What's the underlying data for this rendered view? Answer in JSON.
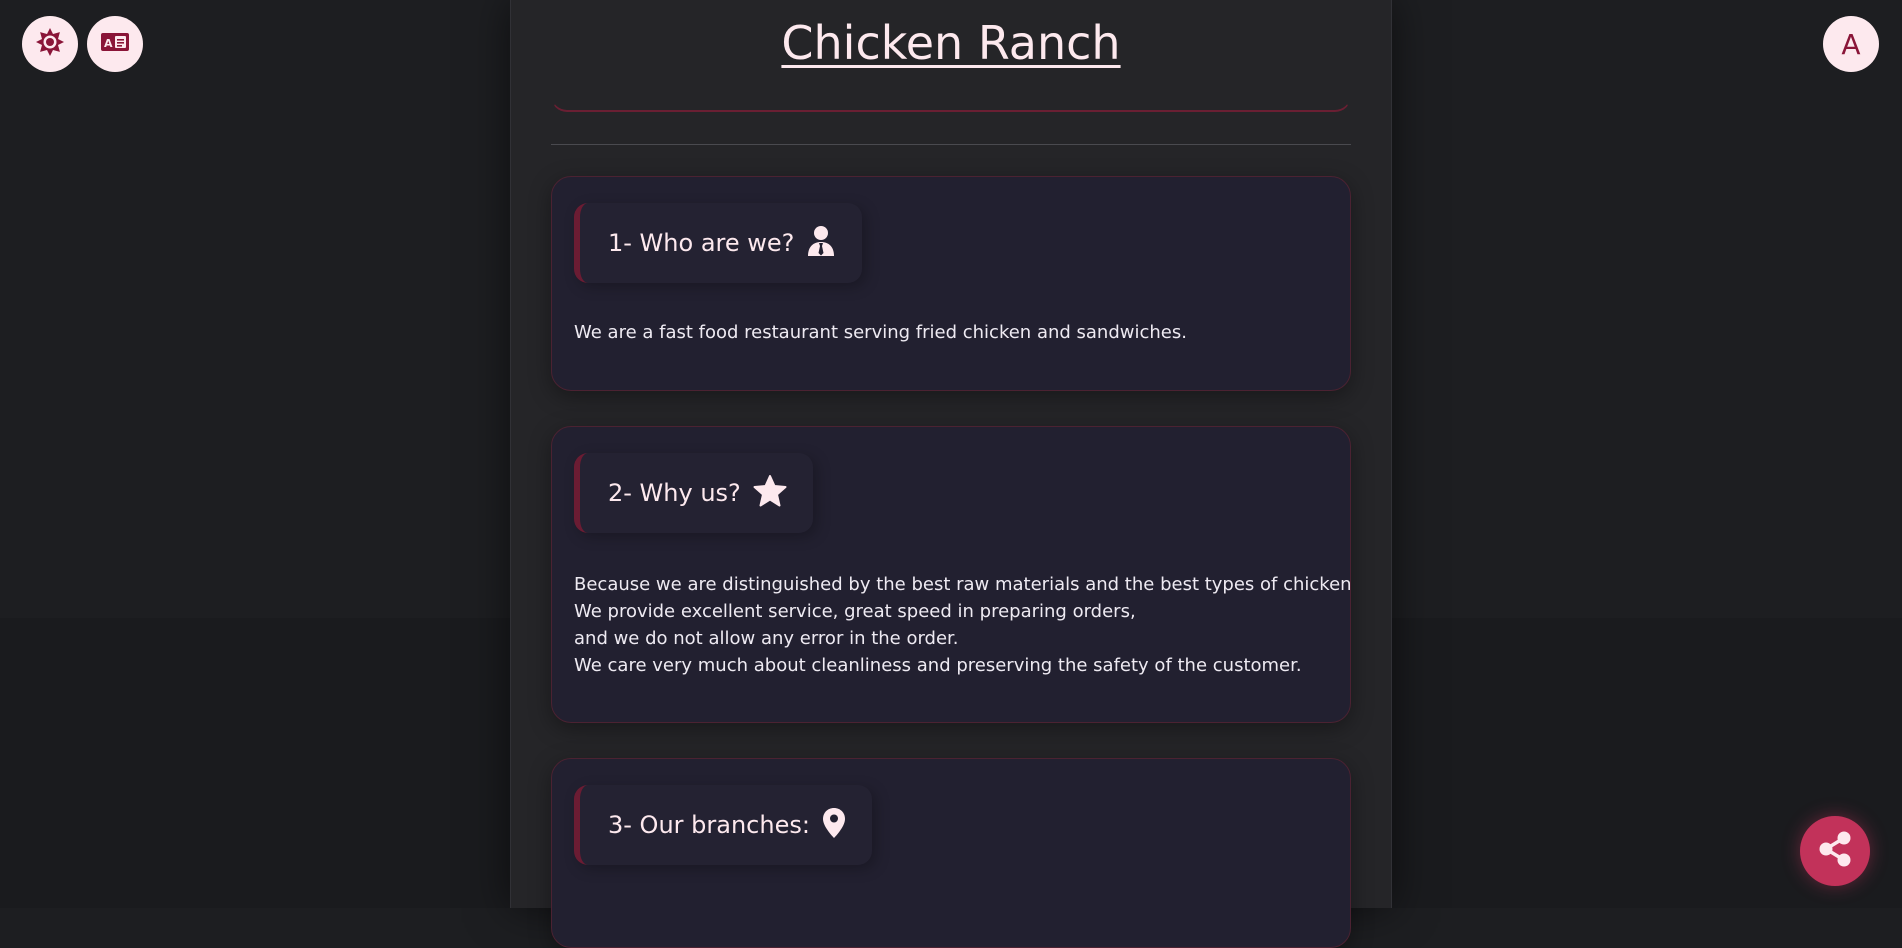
{
  "header": {
    "title": "Chicken Ranch",
    "avatar_letter": "A"
  },
  "icons": {
    "theme_toggle": "sun-gear-icon",
    "language_toggle": "translate-icon",
    "share": "share-icon"
  },
  "colors": {
    "accent": "#8a1538",
    "share_button": "#c2325a",
    "text": "#fde9ee"
  },
  "sections": [
    {
      "title": "1- Who are we?",
      "icon": "person-tie-icon",
      "lines": [
        "We are a fast food restaurant serving fried chicken and sandwiches."
      ]
    },
    {
      "title": "2- Why us?",
      "icon": "star-icon",
      "lines": [
        "Because we are distinguished by the best raw materials and the best types of chicken.",
        "We provide excellent service, great speed in preparing orders,",
        "and we do not allow any error in the order.",
        "We care very much about cleanliness and preserving the safety of the customer."
      ]
    },
    {
      "title": "3- Our branches:",
      "icon": "location-pin-icon",
      "lines": []
    }
  ]
}
